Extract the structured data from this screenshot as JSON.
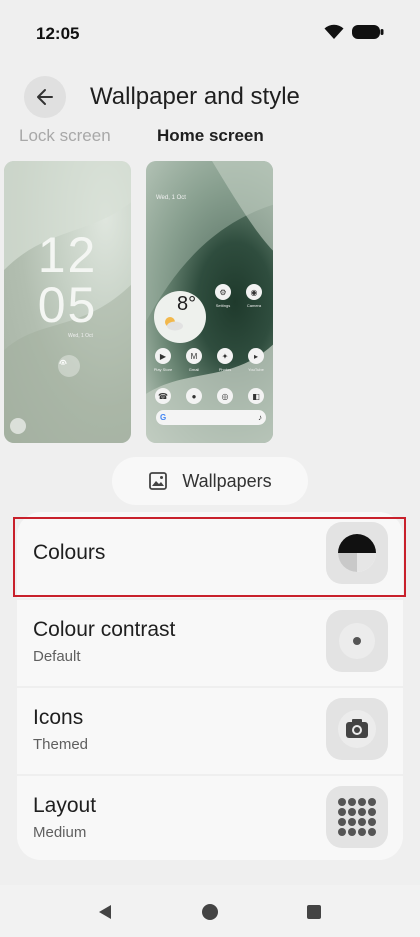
{
  "status_bar": {
    "time": "12:05",
    "icons": [
      "wifi-icon",
      "battery-icon"
    ]
  },
  "app_bar": {
    "title": "Wallpaper and style",
    "back_icon": "arrow-back-icon"
  },
  "screen_tabs": {
    "lock": "Lock screen",
    "home": "Home screen",
    "selected": "home"
  },
  "lock_preview": {
    "clock_hours": "12",
    "clock_minutes": "05",
    "date": "Wed, 1 Oct"
  },
  "home_preview": {
    "date": "Wed, 1 Oct",
    "temperature": "8°",
    "apps_row1": [
      "Settings",
      "Camera"
    ],
    "apps_row2": [
      "Play Store",
      "Gmail",
      "Photos",
      "YouTube"
    ]
  },
  "wallpapers_button": {
    "label": "Wallpapers",
    "icon": "image-icon"
  },
  "settings": [
    {
      "title": "Colours",
      "subtitle": "",
      "icon": "color-palette-icon",
      "highlighted": true
    },
    {
      "title": "Colour contrast",
      "subtitle": "Default",
      "icon": "contrast-icon"
    },
    {
      "title": "Icons",
      "subtitle": "Themed",
      "icon": "camera-icon"
    },
    {
      "title": "Layout",
      "subtitle": "Medium",
      "icon": "grid-icon"
    }
  ],
  "nav_bar": {
    "icons": [
      "back-triangle-icon",
      "home-circle-icon",
      "recents-square-icon"
    ]
  },
  "colors": {
    "background": "#efefef",
    "card": "#f8f8f8",
    "highlight_border": "#c8202b"
  }
}
